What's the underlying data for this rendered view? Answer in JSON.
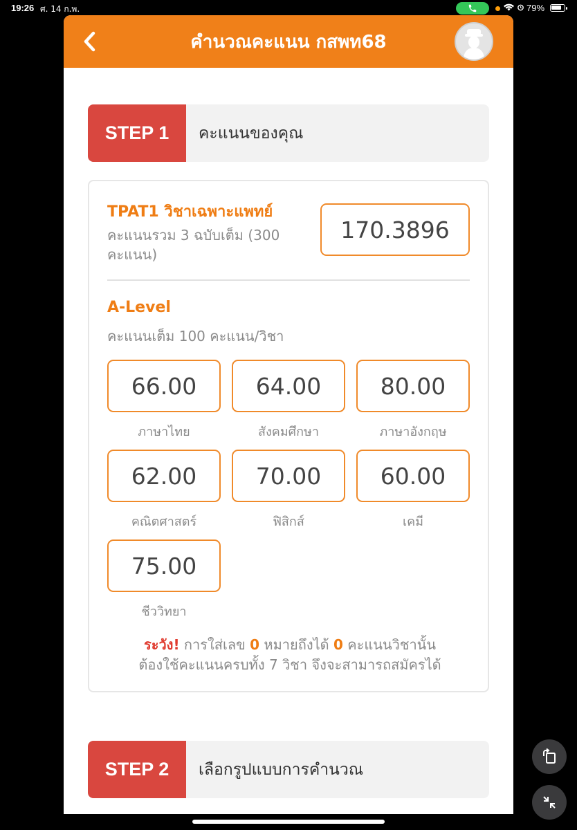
{
  "status_bar": {
    "time": "19:26",
    "date": "ศ. 14 ก.พ.",
    "battery": "79%"
  },
  "header": {
    "title": "คำนวณคะแนน กสพท68"
  },
  "step1": {
    "badge": "STEP 1",
    "label": "คะแนนของคุณ"
  },
  "tpat1": {
    "title": "TPAT1 วิชาเฉพาะแพทย์",
    "description": "คะแนนรวม 3 ฉบับเต็ม (300 คะแนน)",
    "value": "170.3896"
  },
  "alevel": {
    "title": "A-Level",
    "description": "คะแนนเต็ม 100 คะแนน/วิชา",
    "subjects": [
      {
        "value": "66.00",
        "label": "ภาษาไทย"
      },
      {
        "value": "64.00",
        "label": "สังคมศึกษา"
      },
      {
        "value": "80.00",
        "label": "ภาษาอังกฤษ"
      },
      {
        "value": "62.00",
        "label": "คณิตศาสตร์"
      },
      {
        "value": "70.00",
        "label": "ฟิสิกส์"
      },
      {
        "value": "60.00",
        "label": "เคมี"
      },
      {
        "value": "75.00",
        "label": "ชีววิทยา"
      }
    ]
  },
  "warning": {
    "prefix": "ระวัง!",
    "text1": " การใส่เลข ",
    "zero1": "0",
    "text2": " หมายถึงได้ ",
    "zero2": "0",
    "text3": " คะแนนวิชานั้น",
    "line2": "ต้องใช้คะแนนครบทั้ง 7 วิชา จึงจะสามารถสมัครได้"
  },
  "step2": {
    "badge": "STEP 2",
    "label": "เลือกรูปแบบการคำนวณ"
  },
  "colors": {
    "header": "#f08019",
    "step_badge": "#d9473f",
    "accent": "#ef7d14",
    "warning_red": "#e03b2f"
  }
}
